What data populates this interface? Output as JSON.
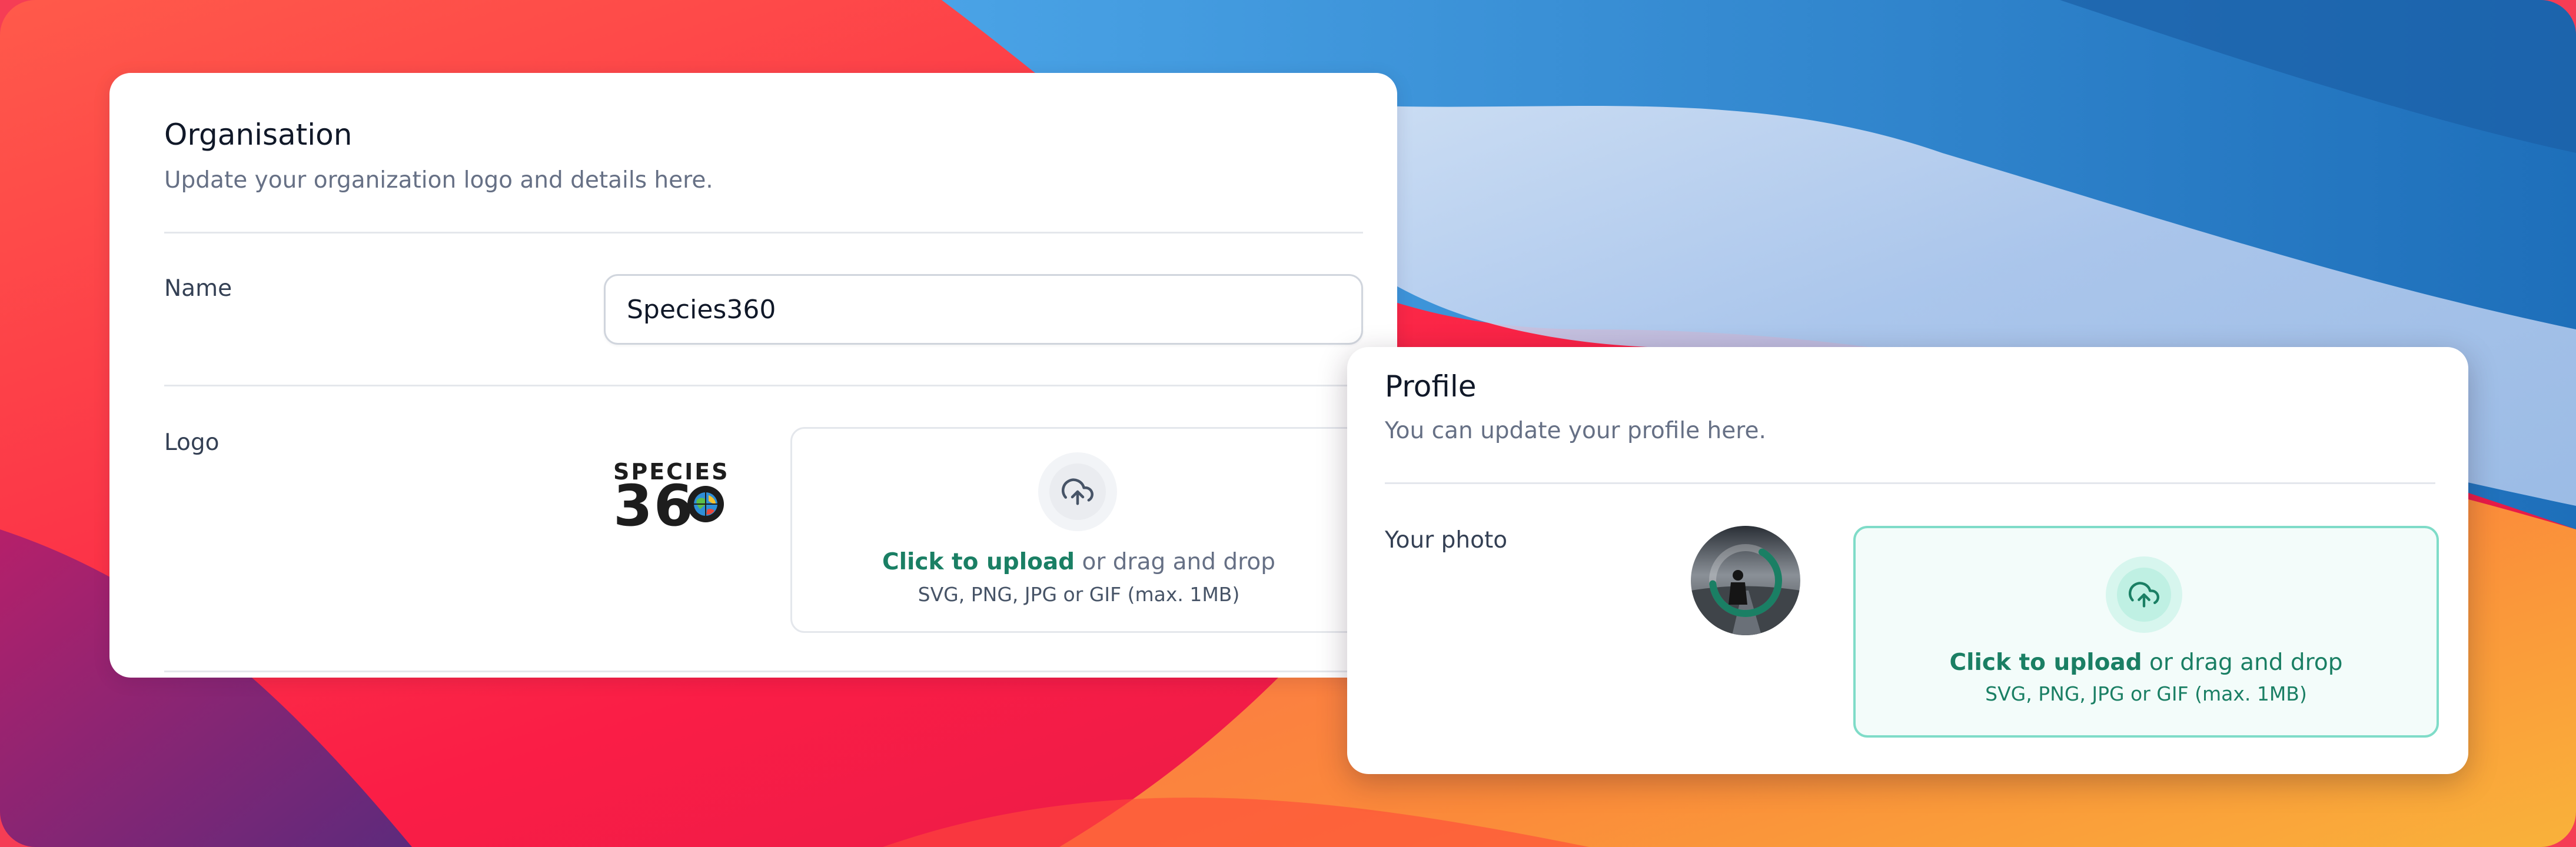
{
  "organisation": {
    "title": "Organisation",
    "subtitle": "Update your organization logo and details here.",
    "name_label": "Name",
    "name_value": "Species360",
    "logo_label": "Logo",
    "logo_word": "SPECIES",
    "logo_number": "36",
    "upload": {
      "icon": "upload-cloud-icon",
      "link_text": "Click to upload",
      "rest_text": " or drag and drop",
      "hint": "SVG, PNG, JPG or GIF (max. 1MB)"
    }
  },
  "profile": {
    "title": "Profile",
    "subtitle": "You can update your profile here.",
    "photo_label": "Your photo",
    "upload_progress": 0.65,
    "upload": {
      "icon": "upload-cloud-icon",
      "link_text": "Click to upload",
      "rest_text": " or drag and drop",
      "hint": "SVG, PNG, JPG or GIF (max. 1MB)"
    }
  },
  "colors": {
    "accent": "#1a7f64",
    "accent_border": "#7fdcc8",
    "accent_bg": "#f3fcfa",
    "text_primary": "#101828",
    "text_secondary": "#667085"
  }
}
